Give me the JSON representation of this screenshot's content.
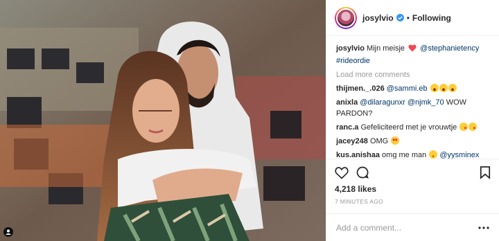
{
  "header": {
    "username": "josylvio",
    "separator": "•",
    "follow_status": "Following"
  },
  "caption": {
    "user": "josylvio",
    "text": "Mijn meisje",
    "mention": "@stephanietency",
    "hashtag": "#rideordie"
  },
  "load_more": "Load more comments",
  "comments": [
    {
      "user": "thijmen._.026",
      "text": "",
      "mention": "@sammi.eb"
    },
    {
      "user": "anixla",
      "text": "",
      "mention": "@dilaragunxr @njmk_70",
      "text_after": "WOW PARDON?"
    },
    {
      "user": "ranc.a",
      "text": "Gefeliciteerd met je vrouwtje",
      "mention": ""
    },
    {
      "user": "jacey248",
      "text": "OMG",
      "mention": ""
    },
    {
      "user": "kus.anishaa",
      "text": "omg me man",
      "mention": "@yysminex"
    }
  ],
  "likes": "4,218 likes",
  "timestamp": "7 MINUTES AGO",
  "add_comment_placeholder": "Add a comment...",
  "colors": {
    "verified": "#3897f0",
    "link": "#003569",
    "heart": "#ed4956"
  },
  "icons": [
    "heart-icon",
    "comment-icon",
    "bookmark-icon",
    "more-options-icon",
    "verified-badge-icon",
    "tag-person-icon"
  ]
}
